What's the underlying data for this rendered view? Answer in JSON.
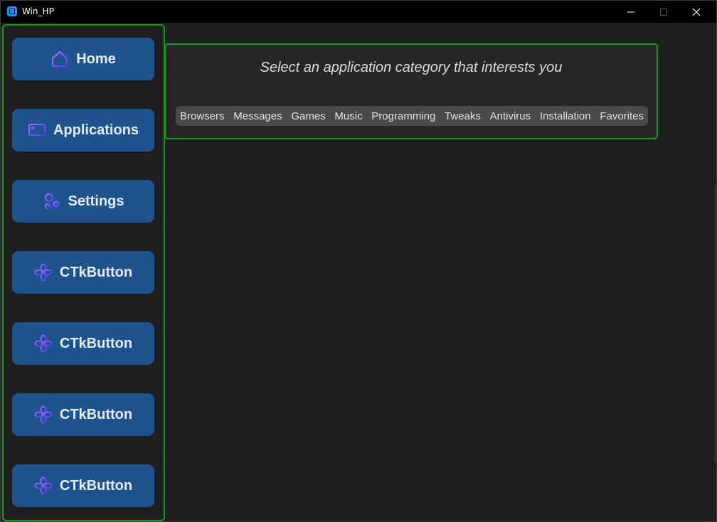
{
  "window": {
    "title": "Win_HP",
    "controls": {
      "minimize": "—",
      "maximize": "☐",
      "close": "✕"
    }
  },
  "colors": {
    "button_bg": "#1f538d",
    "frame_border": "#1a9a1a",
    "icon_purple": "#7b4dff"
  },
  "sidebar": {
    "items": [
      {
        "label": "Home",
        "icon": "home-icon"
      },
      {
        "label": "Applications",
        "icon": "applications-icon"
      },
      {
        "label": "Settings",
        "icon": "settings-icon"
      },
      {
        "label": "CTkButton",
        "icon": "flower-icon"
      },
      {
        "label": "CTkButton",
        "icon": "flower-icon"
      },
      {
        "label": "CTkButton",
        "icon": "flower-icon"
      },
      {
        "label": "CTkButton",
        "icon": "flower-icon"
      }
    ]
  },
  "main": {
    "prompt": "Select an application category that interests you",
    "categories": [
      "Browsers",
      "Messages",
      "Games",
      "Music",
      "Programming",
      "Tweaks",
      "Antivirus",
      "Installation",
      "Favorites"
    ]
  }
}
